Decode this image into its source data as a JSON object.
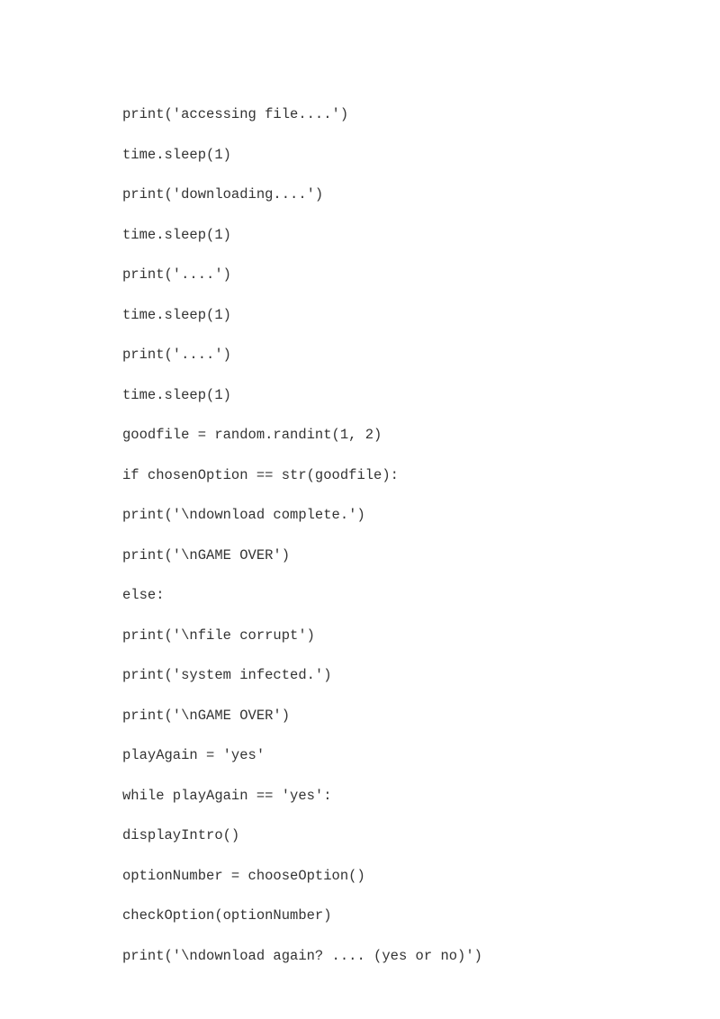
{
  "code": {
    "lines": [
      "print('accessing file....')",
      "time.sleep(1)",
      "print('downloading....')",
      "time.sleep(1)",
      "print('....')",
      "time.sleep(1)",
      "print('....')",
      "time.sleep(1)",
      "goodfile = random.randint(1, 2)",
      "if chosenOption == str(goodfile):",
      "print('\\ndownload complete.')",
      "print('\\nGAME OVER')",
      "else:",
      "print('\\nfile corrupt')",
      "print('system infected.')",
      "print('\\nGAME OVER')",
      "playAgain = 'yes'",
      "while playAgain == 'yes':",
      "displayIntro()",
      "optionNumber = chooseOption()",
      "checkOption(optionNumber)",
      "print('\\ndownload again? .... (yes or no)')"
    ]
  }
}
